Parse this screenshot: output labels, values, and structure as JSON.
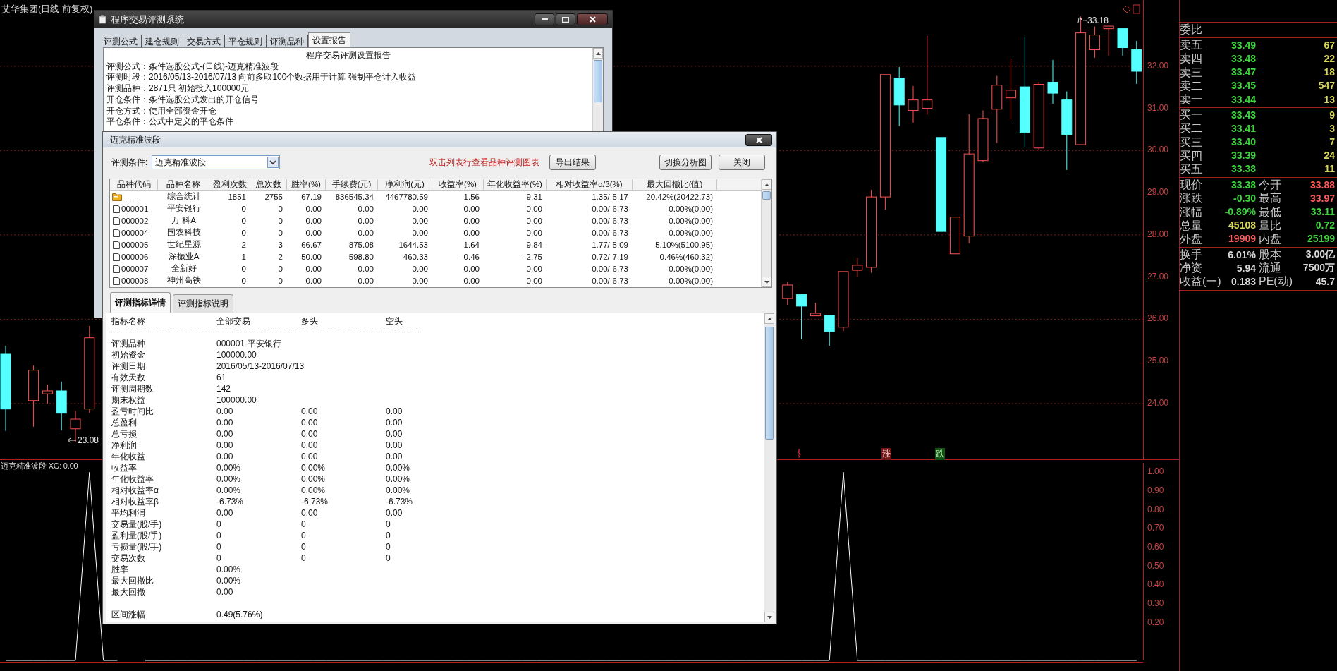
{
  "chart_title": "艾华集团(日线 前复权)",
  "price_chart": {
    "chart_data": {
      "type": "candlestick",
      "grid": true,
      "ohlc": [
        [
          25.17,
          25.37,
          23.35,
          23.87
        ],
        null,
        [
          24.07,
          24.9,
          23.45,
          24.79
        ],
        [
          24.23,
          24.45,
          24.0,
          24.3
        ],
        [
          24.3,
          24.52,
          23.36,
          23.77
        ],
        [
          23.4,
          23.83,
          23.08,
          23.63
        ],
        [
          23.87,
          25.84,
          23.78,
          25.56
        ],
        null,
        null,
        null,
        null,
        null,
        null,
        null,
        null,
        null,
        null,
        null,
        null,
        null,
        null,
        null,
        null,
        null,
        null,
        null,
        null,
        null,
        null,
        null,
        null,
        null,
        null,
        null,
        null,
        null,
        null,
        null,
        null,
        null,
        null,
        null,
        null,
        null,
        null,
        null,
        null,
        null,
        null,
        null,
        null,
        null,
        null,
        null,
        null,
        null,
        [
          26.49,
          26.88,
          26.34,
          26.81
        ],
        [
          26.59,
          26.59,
          25.52,
          26.31
        ],
        [
          26.08,
          26.39,
          26.08,
          26.14
        ],
        [
          26.09,
          26.09,
          25.37,
          25.71
        ],
        [
          25.81,
          27.13,
          25.72,
          27.13
        ],
        [
          27.16,
          27.46,
          27.01,
          27.28
        ],
        [
          27.23,
          29.07,
          27.1,
          28.9
        ],
        [
          28.9,
          31.8,
          28.6,
          31.8
        ],
        [
          31.72,
          31.98,
          30.58,
          31.08
        ],
        [
          30.95,
          31.53,
          30.66,
          31.2
        ],
        [
          31.0,
          32.72,
          30.85,
          31.2
        ],
        [
          30.31,
          30.31,
          28.08,
          28.08
        ],
        [
          27.55,
          28.42,
          27.55,
          28.42
        ],
        [
          27.97,
          30.86,
          27.8,
          29.92
        ],
        [
          29.76,
          30.95,
          29.72,
          30.76
        ],
        [
          30.98,
          31.77,
          30.18,
          31.55
        ],
        [
          31.25,
          32.18,
          30.73,
          31.43
        ],
        [
          31.51,
          32.69,
          30.08,
          30.43
        ],
        [
          30.06,
          31.63,
          30.01,
          31.57
        ],
        [
          31.62,
          32.15,
          31.11,
          31.36
        ],
        [
          31.2,
          31.4,
          29.54,
          30.38
        ],
        [
          30.14,
          33.18,
          30.14,
          32.79
        ],
        [
          32.39,
          32.94,
          32.2,
          32.74
        ],
        [
          32.89,
          32.95,
          32.25,
          32.95
        ],
        [
          32.89,
          32.89,
          32.25,
          32.44
        ],
        [
          32.39,
          32.6,
          31.58,
          31.88
        ]
      ],
      "ylim": [
        22.66,
        33.57
      ],
      "yticks": [
        {
          "value": 32,
          "label": "32.00"
        },
        {
          "value": 31,
          "label": "31.00"
        },
        {
          "value": 30,
          "label": "30.00"
        },
        {
          "value": 29,
          "label": "29.00"
        },
        {
          "value": 28,
          "label": "28.00"
        },
        {
          "value": 27,
          "label": "27.00"
        },
        {
          "value": 26,
          "label": "26.00"
        },
        {
          "value": 25,
          "label": "25.00"
        },
        {
          "value": 24,
          "label": "24.00"
        }
      ]
    }
  },
  "price_marks": [
    {
      "kind": "high",
      "label": "33.18"
    },
    {
      "kind": "low",
      "label": "23.08"
    }
  ],
  "signals": [
    {
      "kind": "rise",
      "label": "涨"
    },
    {
      "kind": "fall",
      "label": "跌"
    }
  ],
  "indicator": {
    "title": "迈克精准波段 XG: 0.00",
    "chart_data": {
      "type": "line",
      "color": "#ffffff",
      "values": [
        0,
        0,
        0,
        0,
        0,
        0,
        1,
        0,
        0,
        null,
        0,
        0,
        0,
        0,
        0,
        0,
        0,
        0,
        0,
        0,
        0,
        0,
        0,
        0,
        0,
        0,
        0,
        0,
        0,
        0,
        0,
        0,
        0,
        0,
        0,
        0,
        0,
        0,
        0,
        0,
        0,
        0,
        0,
        0,
        0,
        0,
        0,
        0,
        0,
        0,
        0,
        0,
        0,
        0,
        0,
        0,
        0,
        0,
        0,
        0,
        1,
        0,
        0,
        0,
        0,
        0,
        0,
        0,
        0,
        0,
        0,
        0,
        0,
        0,
        0,
        0,
        0,
        0,
        0,
        0,
        0,
        0
      ],
      "ylim": [
        0,
        1.05
      ],
      "yticks": [
        {
          "value": 1,
          "label": "1.00"
        },
        {
          "value": 0.9,
          "label": "0.90"
        },
        {
          "value": 0.8,
          "label": "0.80"
        },
        {
          "value": 0.7,
          "label": "0.70"
        },
        {
          "value": 0.6,
          "label": "0.60"
        },
        {
          "value": 0.5,
          "label": "0.50"
        },
        {
          "value": 0.4,
          "label": "0.40"
        },
        {
          "value": 0.3,
          "label": "0.30"
        },
        {
          "value": 0.2,
          "label": "0.20"
        }
      ]
    }
  },
  "quote": {
    "ratio_label": "委比",
    "asks": [
      {
        "label": "卖五",
        "price": "33.49",
        "volume": "67"
      },
      {
        "label": "卖四",
        "price": "33.48",
        "volume": "22"
      },
      {
        "label": "卖三",
        "price": "33.47",
        "volume": "18"
      },
      {
        "label": "卖二",
        "price": "33.45",
        "volume": "547"
      },
      {
        "label": "卖一",
        "price": "33.44",
        "volume": "13"
      }
    ],
    "bids": [
      {
        "label": "买一",
        "price": "33.43",
        "volume": "9"
      },
      {
        "label": "买二",
        "price": "33.41",
        "volume": "3"
      },
      {
        "label": "买三",
        "price": "33.40",
        "volume": "7"
      },
      {
        "label": "买四",
        "price": "33.39",
        "volume": "24"
      },
      {
        "label": "买五",
        "price": "33.38",
        "volume": "11"
      }
    ],
    "stats": [
      {
        "label": "现价",
        "value": "33.38",
        "color": "#3ed43e"
      },
      {
        "label": "今开",
        "value": "33.88",
        "color": "#ff5a5a"
      },
      {
        "label": "涨跌",
        "value": "-0.30",
        "color": "#3ed43e"
      },
      {
        "label": "最高",
        "value": "33.97",
        "color": "#ff5a5a"
      },
      {
        "label": "涨幅",
        "value": "-0.89%",
        "color": "#3ed43e"
      },
      {
        "label": "最低",
        "value": "33.11",
        "color": "#3ed43e"
      },
      {
        "label": "总量",
        "value": "45108",
        "color": "#d6d65a"
      },
      {
        "label": "量比",
        "value": "0.72",
        "color": "#3ed43e"
      },
      {
        "label": "外盘",
        "value": "19909",
        "color": "#ff5a5a"
      },
      {
        "label": "内盘",
        "value": "25199",
        "color": "#3ed43e"
      }
    ],
    "info": [
      {
        "label": "换手",
        "value": "6.01%"
      },
      {
        "label": "股本",
        "value": "3.00亿"
      },
      {
        "label": "净资",
        "value": "5.94"
      },
      {
        "label": "流通",
        "value": "7500万"
      },
      {
        "label": "收益(一)",
        "value": "0.183"
      },
      {
        "label": "PE(动)",
        "value": "45.7"
      }
    ]
  },
  "setup_window": {
    "title": "程序交易评测系统",
    "tabs": [
      {
        "label": "评测公式",
        "selected": false
      },
      {
        "label": "建仓规则",
        "selected": false
      },
      {
        "label": "交易方式",
        "selected": false
      },
      {
        "label": "平仓规则",
        "selected": false
      },
      {
        "label": "评测品种",
        "selected": false
      },
      {
        "label": "设置报告",
        "selected": true
      }
    ],
    "report_title": "程序交易评测设置报告",
    "report_lines": [
      "评测公式：条件选股公式-(日线)-迈克精准波段",
      "评测时段：2016/05/13-2016/07/13 向前多取100个数据用于计算 强制平仓计入收益",
      "评测品种：2871只 初始投入100000元",
      "开仓条件：条件选股公式发出的开仓信号",
      "开仓方式：使用全部资金开仓",
      "平仓条件：公式中定义的平仓条件"
    ]
  },
  "result_window": {
    "title": "-迈克精准波段",
    "condition_label": "评测条件:",
    "condition_value": "迈克精准波段",
    "hint": "双击列表行查看品种评测图表",
    "buttons": [
      "导出结果",
      "切换分析图",
      "关闭"
    ],
    "table": {
      "columns": [
        "品种代码",
        "品种名称",
        "盈利次数",
        "总次数",
        "胜率(%)",
        "手续费(元)",
        "净利润(元)",
        "收益率(%)",
        "年化收益率(%)",
        "相对收益率α/β(%)",
        "最大回撤比(值)"
      ],
      "rows": [
        {
          "kind": "summary",
          "cells": [
            "------",
            "综合统计",
            "1851",
            "2755",
            "67.19",
            "836545.34",
            "4467780.59",
            "1.56",
            "9.31",
            "1.35/-5.17",
            "20.42%(20422.73)"
          ]
        },
        {
          "kind": "stock",
          "cells": [
            "000001",
            "平安银行",
            "0",
            "0",
            "0.00",
            "0.00",
            "0.00",
            "0.00",
            "0.00",
            "0.00/-6.73",
            "0.00%(0.00)"
          ]
        },
        {
          "kind": "stock",
          "cells": [
            "000002",
            "万 科A",
            "0",
            "0",
            "0.00",
            "0.00",
            "0.00",
            "0.00",
            "0.00",
            "0.00/-6.73",
            "0.00%(0.00)"
          ]
        },
        {
          "kind": "stock",
          "cells": [
            "000004",
            "国农科技",
            "0",
            "0",
            "0.00",
            "0.00",
            "0.00",
            "0.00",
            "0.00",
            "0.00/-6.73",
            "0.00%(0.00)"
          ]
        },
        {
          "kind": "stock",
          "cells": [
            "000005",
            "世纪星源",
            "2",
            "3",
            "66.67",
            "875.08",
            "1644.53",
            "1.64",
            "9.84",
            "1.77/-5.09",
            "5.10%(5100.95)"
          ]
        },
        {
          "kind": "stock",
          "cells": [
            "000006",
            "深振业A",
            "1",
            "2",
            "50.00",
            "598.80",
            "-460.33",
            "-0.46",
            "-2.75",
            "0.72/-7.19",
            "0.46%(460.32)"
          ]
        },
        {
          "kind": "stock",
          "cells": [
            "000007",
            "全新好",
            "0",
            "0",
            "0.00",
            "0.00",
            "0.00",
            "0.00",
            "0.00",
            "0.00/-6.73",
            "0.00%(0.00)"
          ]
        },
        {
          "kind": "stock",
          "cells": [
            "000008",
            "神州高铁",
            "0",
            "0",
            "0.00",
            "0.00",
            "0.00",
            "0.00",
            "0.00",
            "0.00/-6.73",
            "0.00%(0.00)"
          ]
        }
      ]
    },
    "detail_tabs": [
      {
        "label": "评测指标详情",
        "selected": true
      },
      {
        "label": "评测指标说明",
        "selected": false
      }
    ],
    "detail": {
      "columns": [
        "指标名称",
        "全部交易",
        "多头",
        "空头"
      ],
      "rows": [
        {
          "kind": "metric",
          "cells": [
            "评测品种",
            "000001-平安银行"
          ]
        },
        {
          "kind": "metric",
          "cells": [
            "初始资金",
            "100000.00"
          ]
        },
        {
          "kind": "metric",
          "cells": [
            "评测日期",
            "2016/05/13-2016/07/13"
          ]
        },
        {
          "kind": "metric",
          "cells": [
            "有效天数",
            "61"
          ]
        },
        {
          "kind": "metric",
          "cells": [
            "评测周期数",
            "142"
          ]
        },
        {
          "kind": "metric",
          "cells": [
            "期末权益",
            "100000.00"
          ]
        },
        {
          "kind": "metric",
          "cells": [
            "盈亏时间比",
            "0.00",
            "0.00",
            "0.00"
          ]
        },
        {
          "kind": "metric",
          "cells": [
            "总盈利",
            "0.00",
            "0.00",
            "0.00"
          ]
        },
        {
          "kind": "metric",
          "cells": [
            "总亏损",
            "0.00",
            "0.00",
            "0.00"
          ]
        },
        {
          "kind": "metric",
          "cells": [
            "净利润",
            "0.00",
            "0.00",
            "0.00"
          ]
        },
        {
          "kind": "metric",
          "cells": [
            "年化收益",
            "0.00",
            "0.00",
            "0.00"
          ]
        },
        {
          "kind": "metric",
          "cells": [
            "收益率",
            "0.00%",
            "0.00%",
            "0.00%"
          ]
        },
        {
          "kind": "metric",
          "cells": [
            "年化收益率",
            "0.00%",
            "0.00%",
            "0.00%"
          ]
        },
        {
          "kind": "metric",
          "cells": [
            "相对收益率α",
            "0.00%",
            "0.00%",
            "0.00%"
          ]
        },
        {
          "kind": "metric",
          "cells": [
            "相对收益率β",
            "-6.73%",
            "-6.73%",
            "-6.73%"
          ]
        },
        {
          "kind": "metric",
          "cells": [
            "平均利润",
            "0.00",
            "0.00",
            "0.00"
          ]
        },
        {
          "kind": "metric",
          "cells": [
            "交易量(股/手)",
            "0",
            "0",
            "0"
          ]
        },
        {
          "kind": "metric",
          "cells": [
            "盈利量(股/手)",
            "0",
            "0",
            "0"
          ]
        },
        {
          "kind": "metric",
          "cells": [
            "亏损量(股/手)",
            "0",
            "0",
            "0"
          ]
        },
        {
          "kind": "metric",
          "cells": [
            "交易次数",
            "0",
            "0",
            "0"
          ]
        },
        {
          "kind": "metric",
          "cells": [
            "胜率",
            "0.00%"
          ]
        },
        {
          "kind": "metric",
          "cells": [
            "最大回撤比",
            "0.00%"
          ]
        },
        {
          "kind": "metric",
          "cells": [
            "最大回撤",
            "0.00"
          ]
        },
        {
          "kind": "after_gap",
          "cells": [
            "区间涨幅",
            "0.49(5.76%)"
          ]
        }
      ]
    }
  }
}
